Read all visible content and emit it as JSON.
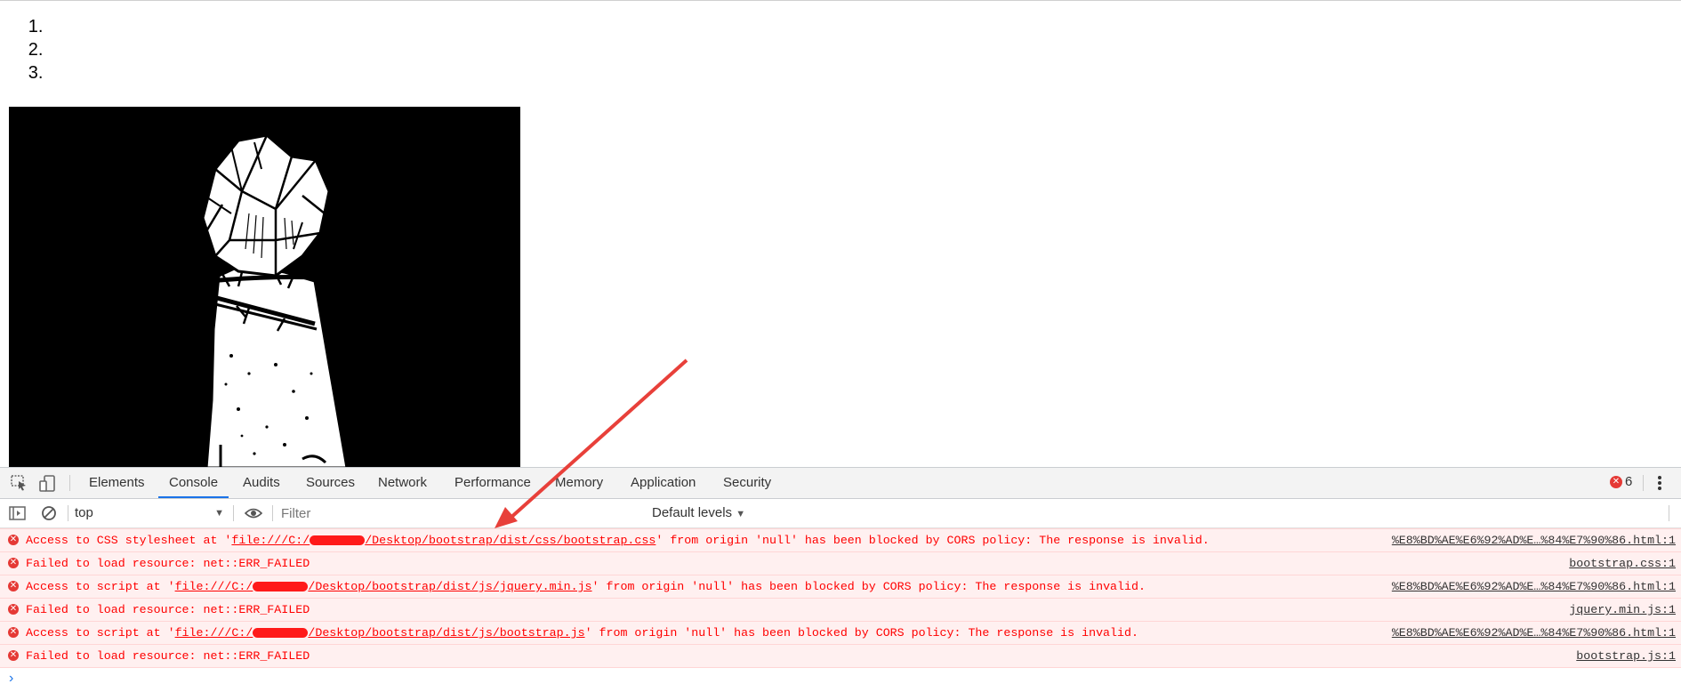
{
  "page": {
    "list_items": [
      "",
      "",
      ""
    ]
  },
  "devtools": {
    "tabs": [
      "Elements",
      "Console",
      "Audits",
      "Sources",
      "Network",
      "Performance",
      "Memory",
      "Application",
      "Security"
    ],
    "active_tab": "Console",
    "error_count": "6",
    "context": "top",
    "filter_placeholder": "Filter",
    "levels_label": "Default levels"
  },
  "console": {
    "messages": [
      {
        "pre": "Access to CSS stylesheet at '",
        "url_a": "file:///C:/",
        "url_b": "/Desktop/bootstrap/dist/css/bootstrap.css",
        "post": "' from origin 'null' has been blocked by CORS policy: The response is invalid.",
        "source": "%E8%BD%AE%E6%92%AD%E…%84%E7%90%86.html:1"
      },
      {
        "text": "Failed to load resource: net::ERR_FAILED",
        "source": "bootstrap.css:1"
      },
      {
        "pre": "Access to script at '",
        "url_a": "file:///C:/",
        "url_b": "/Desktop/bootstrap/dist/js/jquery.min.js",
        "post": "' from origin 'null' has been blocked by CORS policy: The response is invalid.",
        "source": "%E8%BD%AE%E6%92%AD%E…%84%E7%90%86.html:1"
      },
      {
        "text": "Failed to load resource: net::ERR_FAILED",
        "source": "jquery.min.js:1"
      },
      {
        "pre": "Access to script at '",
        "url_a": "file:///C:/",
        "url_b": "/Desktop/bootstrap/dist/js/bootstrap.js",
        "post": "' from origin 'null' has been blocked by CORS policy: The response is invalid.",
        "source": "%E8%BD%AE%E6%92%AD%E…%84%E7%90%86.html:1"
      },
      {
        "text": "Failed to load resource: net::ERR_FAILED",
        "source": "bootstrap.js:1"
      }
    ]
  },
  "colors": {
    "error_text": "#ff0000",
    "error_bg": "#fff0f0",
    "active_tab_underline": "#1a73e8",
    "annotation_arrow": "#e8403a"
  },
  "icons": [
    "inspect-element-icon",
    "device-toolbar-icon",
    "error-count-icon",
    "kebab-menu-icon",
    "sidebar-toggle-icon",
    "clear-console-icon",
    "eye-icon",
    "error-icon",
    "prompt-chevron-icon"
  ]
}
